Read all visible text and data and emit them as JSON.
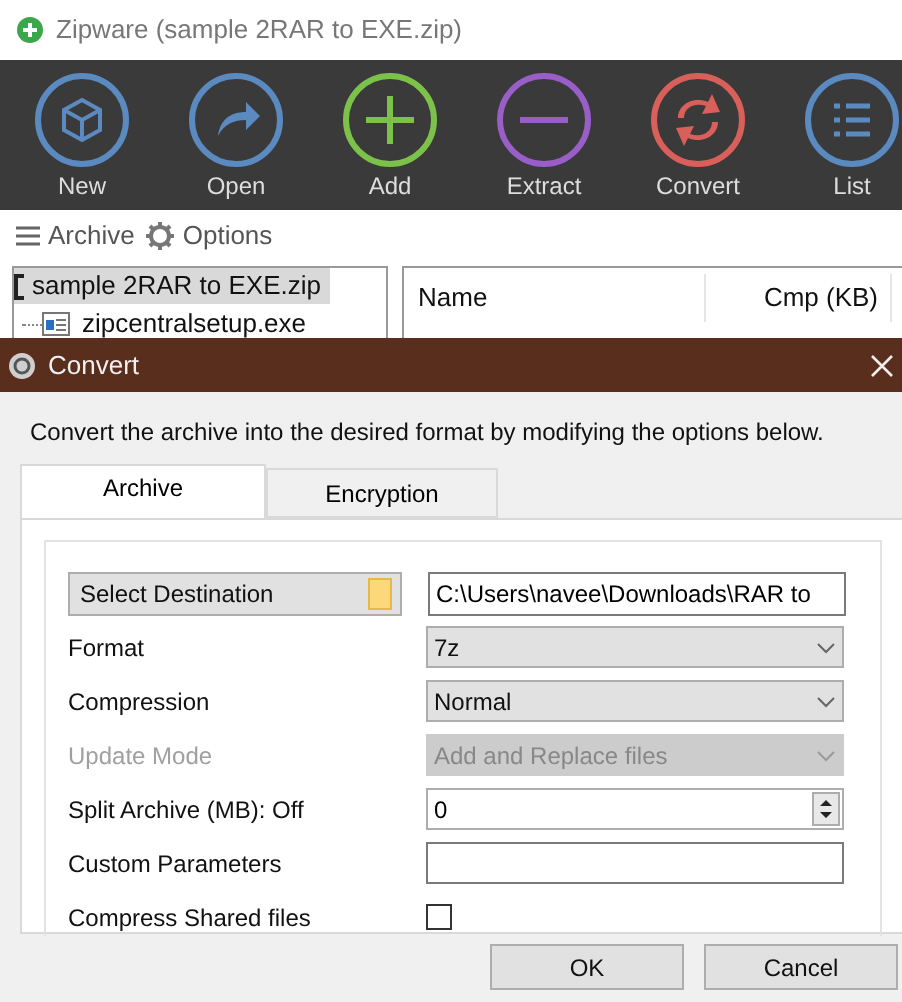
{
  "window": {
    "title": "Zipware (sample 2RAR to EXE.zip)"
  },
  "toolbar": [
    {
      "label": "New",
      "kind": "new",
      "color": "#5b8ac0"
    },
    {
      "label": "Open",
      "kind": "open",
      "color": "#5b8ac0"
    },
    {
      "label": "Add",
      "kind": "add",
      "color": "#7cc24a"
    },
    {
      "label": "Extract",
      "kind": "extract",
      "color": "#9a5ec8"
    },
    {
      "label": "Convert",
      "kind": "convert",
      "color": "#d9605a"
    },
    {
      "label": "List",
      "kind": "list",
      "color": "#5b8ac0"
    }
  ],
  "menu": [
    {
      "label": "Archive",
      "kind": "menu"
    },
    {
      "label": "Options",
      "kind": "gear"
    }
  ],
  "tree": [
    {
      "label": "sample 2RAR to EXE.zip",
      "selected": true,
      "children": [
        {
          "label": "zipcentralsetup.exe",
          "selected": false
        }
      ]
    }
  ],
  "file_list": {
    "columns": [
      "Name",
      "Cmp (KB)"
    ]
  },
  "dialog": {
    "title": "Convert",
    "description": "Convert the archive into the desired format by modifying the options below.",
    "tabs": [
      {
        "label": "Archive",
        "selected": true
      },
      {
        "label": "Encryption",
        "selected": false
      }
    ],
    "rows": [
      {
        "kind": "destination",
        "label": "Select Destination",
        "value": "C:\\Users\\navee\\Downloads\\RAR to"
      },
      {
        "kind": "select",
        "label": "Format",
        "value": "7z",
        "disabled": false
      },
      {
        "kind": "select",
        "label": "Compression",
        "value": "Normal",
        "disabled": false
      },
      {
        "kind": "select",
        "label": "Update Mode",
        "value": "Add and Replace files",
        "disabled": true
      },
      {
        "kind": "spin",
        "label": "Split Archive (MB): Off",
        "value": "0"
      },
      {
        "kind": "text",
        "label": "Custom Parameters"
      },
      {
        "kind": "checkbox",
        "label": "Compress Shared files",
        "checked": false
      }
    ],
    "buttons": [
      "OK",
      "Cancel"
    ]
  }
}
